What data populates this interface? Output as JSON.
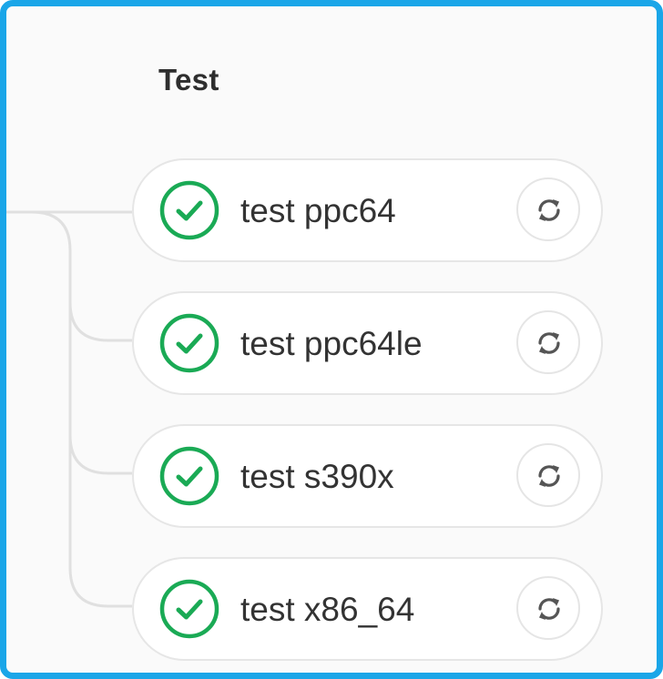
{
  "stage": {
    "title": "Test"
  },
  "jobs": [
    {
      "name": "test ppc64",
      "status": "passed",
      "status_icon": "check-circle-icon",
      "action_icon": "retry-icon"
    },
    {
      "name": "test ppc64le",
      "status": "passed",
      "status_icon": "check-circle-icon",
      "action_icon": "retry-icon"
    },
    {
      "name": "test s390x",
      "status": "passed",
      "status_icon": "check-circle-icon",
      "action_icon": "retry-icon"
    },
    {
      "name": "test x86_64",
      "status": "passed",
      "status_icon": "check-circle-icon",
      "action_icon": "retry-icon"
    }
  ],
  "colors": {
    "frame_border": "#1aa6e8",
    "success": "#1aaa55",
    "connector": "#e0e0e0",
    "text": "#333333"
  }
}
